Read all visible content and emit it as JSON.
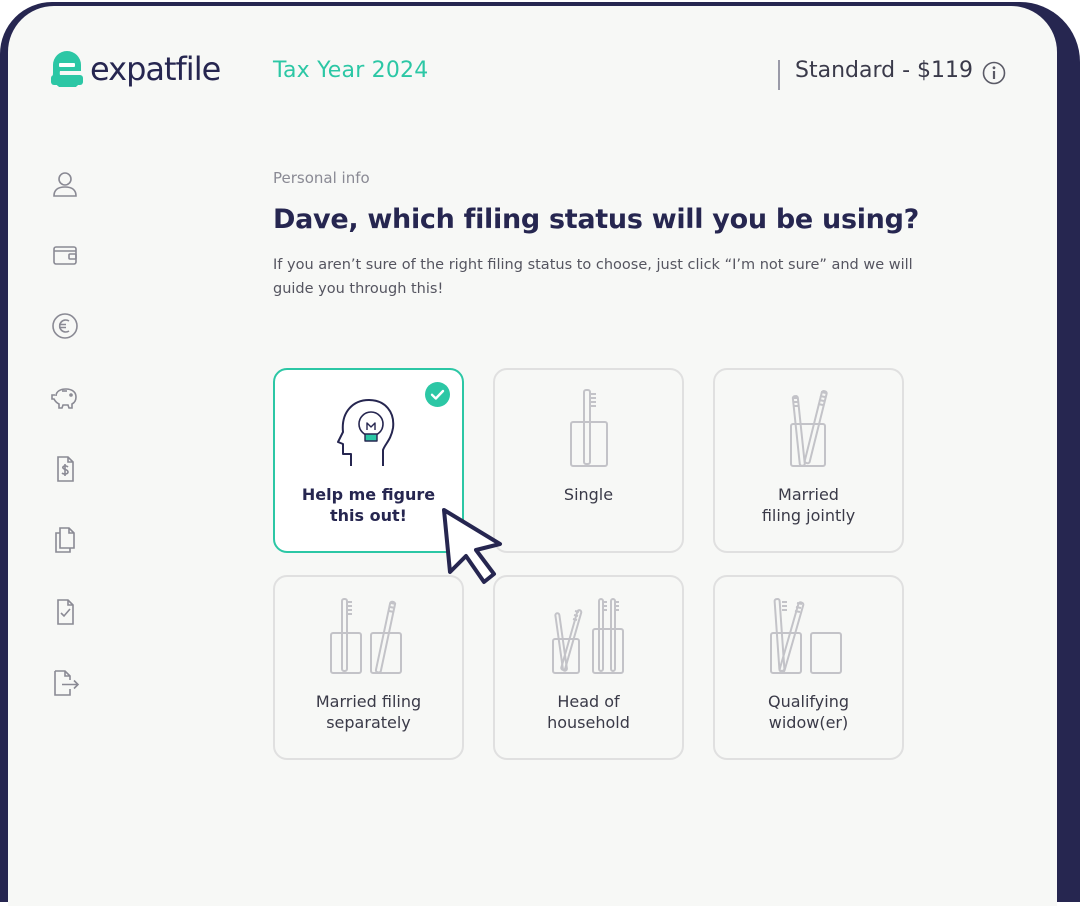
{
  "header": {
    "brand": "expatfile",
    "tax_year": "Tax Year 2024",
    "plan": "Standard - $119"
  },
  "sidebar": {
    "items": [
      {
        "icon": "user-icon"
      },
      {
        "icon": "wallet-icon"
      },
      {
        "icon": "euro-icon"
      },
      {
        "icon": "piggy-bank-icon"
      },
      {
        "icon": "invoice-dollar-icon"
      },
      {
        "icon": "documents-icon"
      },
      {
        "icon": "document-check-icon"
      },
      {
        "icon": "exit-icon"
      }
    ]
  },
  "main": {
    "section": "Personal info",
    "question": "Dave, which filing status will you be using?",
    "helper": "If you aren’t sure of the right filing status to choose, just click “I’m not sure” and we will guide you through this!",
    "options": [
      {
        "label": "Help me figure\nthis out!",
        "selected": true,
        "icon": "head-lightbulb-icon"
      },
      {
        "label": "Single",
        "selected": false,
        "icon": "single-toothbrush-icon"
      },
      {
        "label": "Married\nfiling jointly",
        "selected": false,
        "icon": "two-toothbrushes-one-cup-icon"
      },
      {
        "label": "Married filing\nseparately",
        "selected": false,
        "icon": "two-toothbrushes-two-cups-icon"
      },
      {
        "label": "Head of\nhousehold",
        "selected": false,
        "icon": "family-toothbrushes-icon"
      },
      {
        "label": "Qualifying\nwidow(er)",
        "selected": false,
        "icon": "toothbrushes-empty-cup-icon"
      }
    ]
  },
  "colors": {
    "accent": "#2cc7a5",
    "navy": "#262650",
    "card_border": "#e0e0e0",
    "background": "#f7f8f6"
  }
}
